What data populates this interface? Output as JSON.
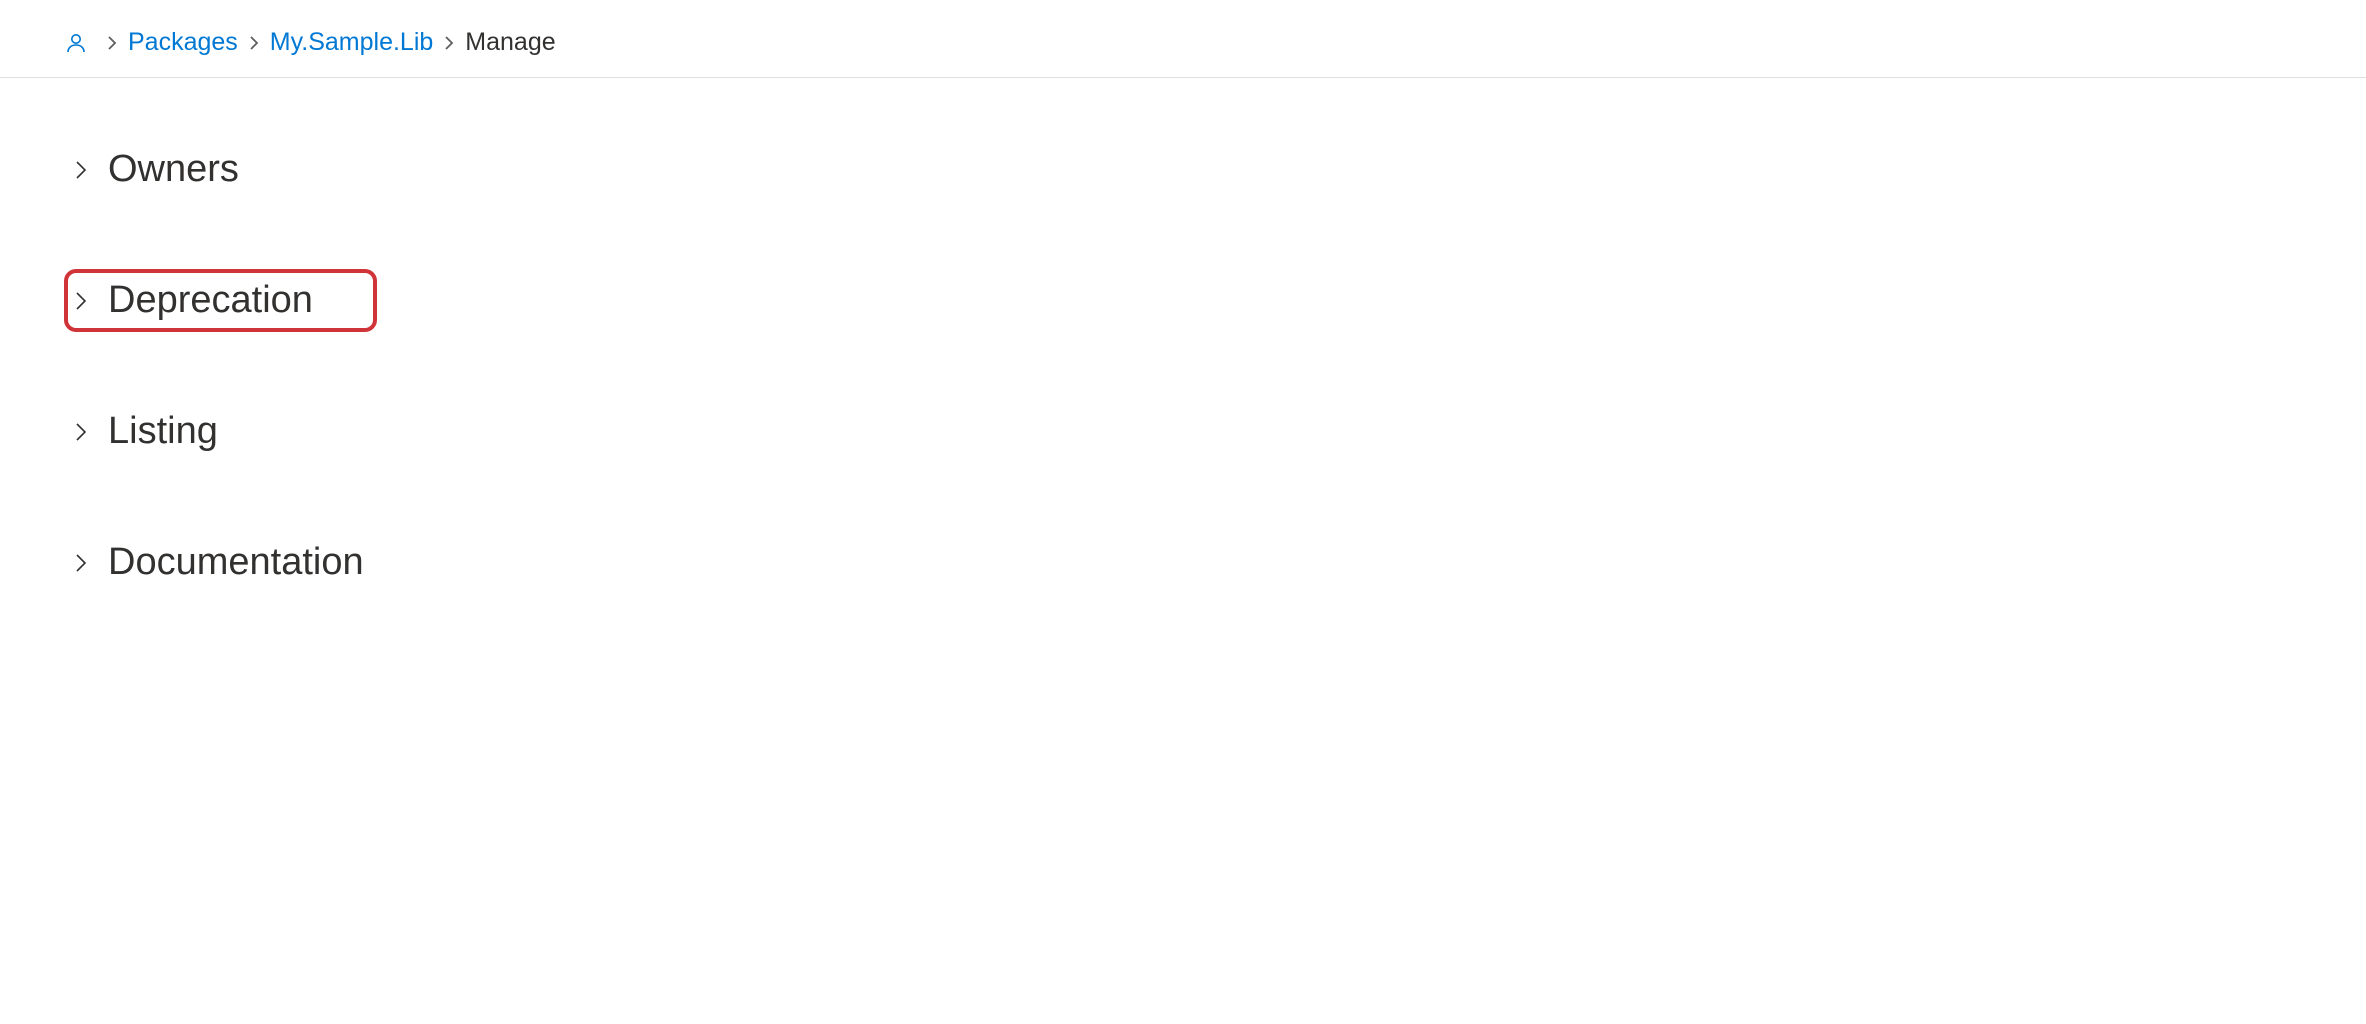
{
  "breadcrumb": {
    "packages_label": "Packages",
    "package_name": "My.Sample.Lib",
    "current": "Manage"
  },
  "sections": [
    {
      "label": "Owners",
      "highlighted": false
    },
    {
      "label": "Deprecation",
      "highlighted": true
    },
    {
      "label": "Listing",
      "highlighted": false
    },
    {
      "label": "Documentation",
      "highlighted": false
    }
  ]
}
